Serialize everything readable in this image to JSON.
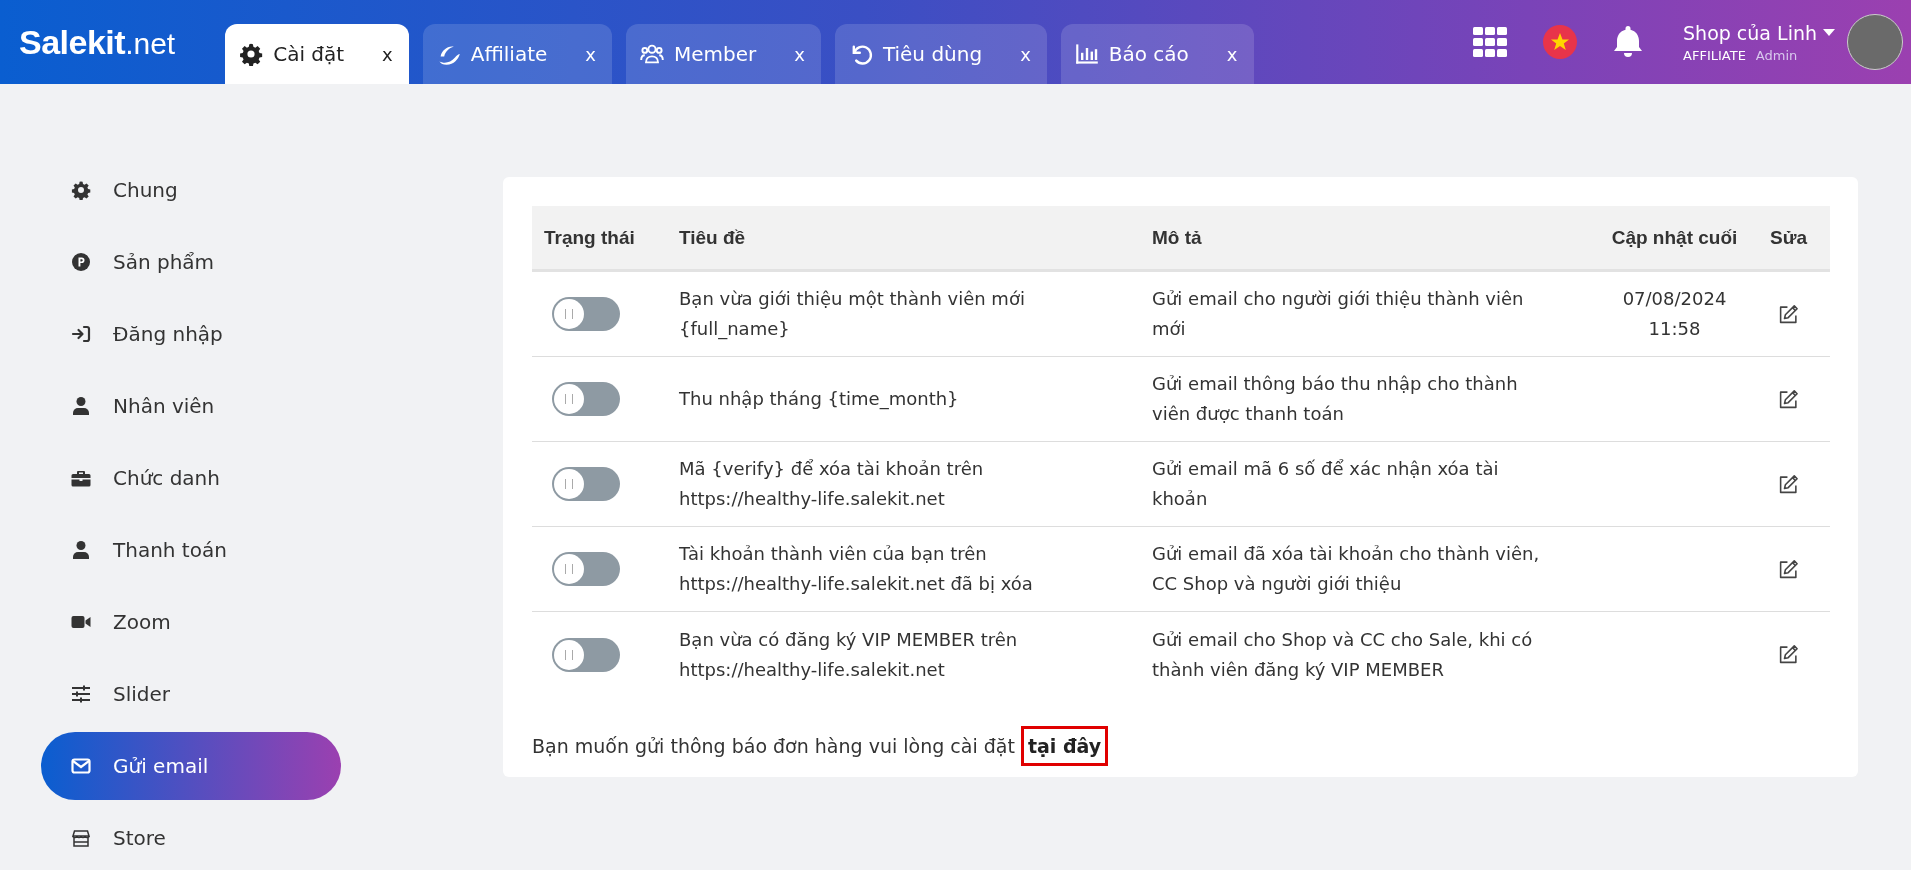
{
  "header": {
    "logo": "Salekit",
    "logo_suffix": ".net",
    "tabs": [
      {
        "label": "Cài đặt",
        "selected": true,
        "close": "x"
      },
      {
        "label": "Affiliate",
        "selected": false,
        "close": "x"
      },
      {
        "label": "Member",
        "selected": false,
        "close": "x"
      },
      {
        "label": "Tiêu dùng",
        "selected": false,
        "close": "x"
      },
      {
        "label": "Báo cáo",
        "selected": false,
        "close": "x"
      }
    ],
    "user": {
      "name": "Shop của Linh",
      "role": "AFFILIATE",
      "level": "Admin"
    }
  },
  "sidebar": {
    "items": [
      {
        "label": "Chung",
        "selected": false
      },
      {
        "label": "Sản phẩm",
        "selected": false
      },
      {
        "label": "Đăng nhập",
        "selected": false
      },
      {
        "label": "Nhân viên",
        "selected": false
      },
      {
        "label": "Chức danh",
        "selected": false
      },
      {
        "label": "Thanh toán",
        "selected": false
      },
      {
        "label": "Zoom",
        "selected": false
      },
      {
        "label": "Slider",
        "selected": false
      },
      {
        "label": "Gửi email",
        "selected": true
      },
      {
        "label": "Store",
        "selected": false
      }
    ]
  },
  "table": {
    "columns": [
      "Trạng thái",
      "Tiêu đề",
      "Mô tả",
      "Cập nhật cuối",
      "Sửa"
    ],
    "rows": [
      {
        "on": false,
        "title": "Bạn vừa giới thiệu một thành viên mới {full_name}",
        "description": "Gửi email cho người giới thiệu thành viên mới",
        "updated": "07/08/2024 11:58"
      },
      {
        "on": false,
        "title": "Thu nhập tháng {time_month}",
        "description": "Gửi email thông báo thu nhập cho thành viên được thanh toán"
      },
      {
        "on": false,
        "title": "Mã {verify} để xóa tài khoản trên https://healthy-life.salekit.net",
        "description": "Gửi email mã 6 số để xác nhận xóa tài khoản"
      },
      {
        "on": false,
        "title": "Tài khoản thành viên của bạn trên https://healthy-life.salekit.net đã bị xóa",
        "description": "Gửi email đã xóa tài khoản cho thành viên, CC Shop và người giới thiệu"
      },
      {
        "on": false,
        "title": "Bạn vừa có đăng ký VIP MEMBER trên https://healthy-life.salekit.net",
        "description": "Gửi email cho Shop và CC cho Sale, khi có thành viên đăng ký VIP MEMBER"
      }
    ]
  },
  "footer_note": {
    "text": "Bạn muốn gửi thông báo đơn hàng vui lòng cài đặt",
    "link": "tại đây",
    "highlighted": true
  }
}
